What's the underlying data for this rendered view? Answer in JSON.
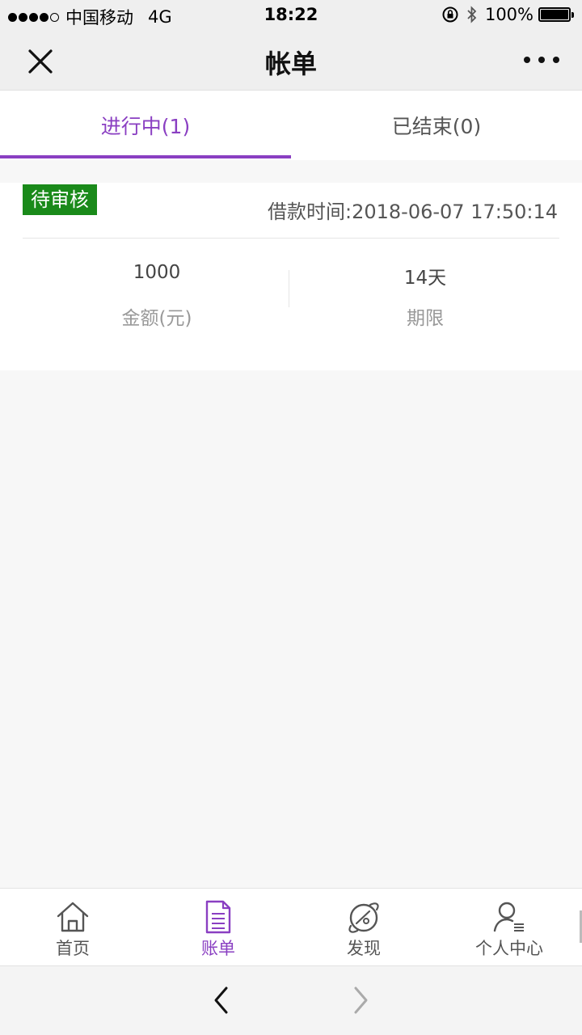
{
  "status_bar": {
    "carrier": "中国移动",
    "network": "4G",
    "time": "18:22",
    "battery": "100%",
    "battery_level": 1.0
  },
  "nav": {
    "title": "帐单"
  },
  "tabs": [
    {
      "label": "进行中(1)",
      "active": true
    },
    {
      "label": "已结束(0)",
      "active": false
    }
  ],
  "loan": {
    "status": "待审核",
    "status_color": "#1a8a1a",
    "borrow_time": "借款时间:2018-06-07 17:50:14",
    "amount_value": "1000",
    "amount_label": "金额(元)",
    "term_value": "14天",
    "term_label": "期限"
  },
  "tab_bar": [
    {
      "label": "首页",
      "icon": "home-icon",
      "active": false
    },
    {
      "label": "账单",
      "icon": "bill-icon",
      "active": true
    },
    {
      "label": "发现",
      "icon": "discover-icon",
      "active": false
    },
    {
      "label": "个人中心",
      "icon": "user-icon",
      "active": false
    }
  ],
  "colors": {
    "accent": "#8a3fc2",
    "badge": "#1a8a1a"
  }
}
